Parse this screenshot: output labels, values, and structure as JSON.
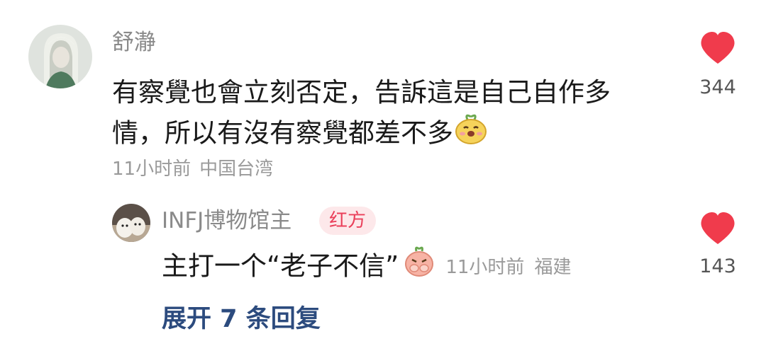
{
  "comment": {
    "username": "舒瀞",
    "text": "有察覺也會立刻否定，告訴這是自己自作多情，所以有沒有察覺都差不多",
    "time": "11小时前",
    "location": "中国台湾",
    "likes": "344",
    "avatar_icon": "anime-character-avatar",
    "emoji_icon": "smiling-face-sticker"
  },
  "reply": {
    "username": "INFJ博物馆主",
    "badge": "红方",
    "text": "主打一个“老子不信”",
    "time": "11小时前",
    "location": "福建",
    "likes": "143",
    "avatar_icon": "dog-photo-avatar",
    "emoji_icon": "covering-mouth-sticker"
  },
  "expand_replies": "展开 7 条回复",
  "colors": {
    "heart": "#f03b4c",
    "badge_bg": "#fde8ea",
    "badge_text": "#ea3f5a",
    "expand_link": "#2c4b7e"
  }
}
